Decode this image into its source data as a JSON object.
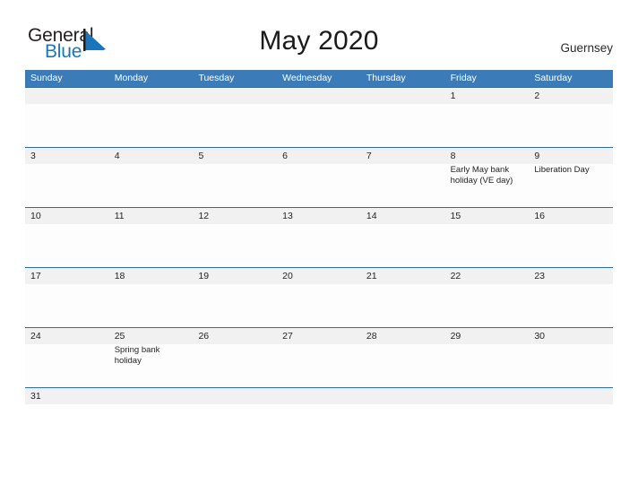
{
  "brand": {
    "word_one": "General",
    "word_two": "Blue",
    "mark": "triangle-logo-mark",
    "accent_color": "#1b75bb"
  },
  "header": {
    "title": "May 2020",
    "locale": "Guernsey",
    "header_bg": "#3b7cb8",
    "rule_color": "#2e6da4",
    "band_color": "#f1f1f1"
  },
  "weekdays": [
    "Sunday",
    "Monday",
    "Tuesday",
    "Wednesday",
    "Thursday",
    "Friday",
    "Saturday"
  ],
  "weeks": [
    {
      "days": [
        {
          "num": "",
          "event": ""
        },
        {
          "num": "",
          "event": ""
        },
        {
          "num": "",
          "event": ""
        },
        {
          "num": "",
          "event": ""
        },
        {
          "num": "",
          "event": ""
        },
        {
          "num": "1",
          "event": ""
        },
        {
          "num": "2",
          "event": ""
        }
      ]
    },
    {
      "days": [
        {
          "num": "3",
          "event": ""
        },
        {
          "num": "4",
          "event": ""
        },
        {
          "num": "5",
          "event": ""
        },
        {
          "num": "6",
          "event": ""
        },
        {
          "num": "7",
          "event": ""
        },
        {
          "num": "8",
          "event": "Early May bank holiday (VE day)"
        },
        {
          "num": "9",
          "event": "Liberation Day"
        }
      ]
    },
    {
      "days": [
        {
          "num": "10",
          "event": ""
        },
        {
          "num": "11",
          "event": ""
        },
        {
          "num": "12",
          "event": ""
        },
        {
          "num": "13",
          "event": ""
        },
        {
          "num": "14",
          "event": ""
        },
        {
          "num": "15",
          "event": ""
        },
        {
          "num": "16",
          "event": ""
        }
      ]
    },
    {
      "days": [
        {
          "num": "17",
          "event": ""
        },
        {
          "num": "18",
          "event": ""
        },
        {
          "num": "19",
          "event": ""
        },
        {
          "num": "20",
          "event": ""
        },
        {
          "num": "21",
          "event": ""
        },
        {
          "num": "22",
          "event": ""
        },
        {
          "num": "23",
          "event": ""
        }
      ]
    },
    {
      "days": [
        {
          "num": "24",
          "event": ""
        },
        {
          "num": "25",
          "event": "Spring bank holiday"
        },
        {
          "num": "26",
          "event": ""
        },
        {
          "num": "27",
          "event": ""
        },
        {
          "num": "28",
          "event": ""
        },
        {
          "num": "29",
          "event": ""
        },
        {
          "num": "30",
          "event": ""
        }
      ]
    },
    {
      "days": [
        {
          "num": "31",
          "event": ""
        },
        {
          "num": "",
          "event": ""
        },
        {
          "num": "",
          "event": ""
        },
        {
          "num": "",
          "event": ""
        },
        {
          "num": "",
          "event": ""
        },
        {
          "num": "",
          "event": ""
        },
        {
          "num": "",
          "event": ""
        }
      ]
    }
  ]
}
